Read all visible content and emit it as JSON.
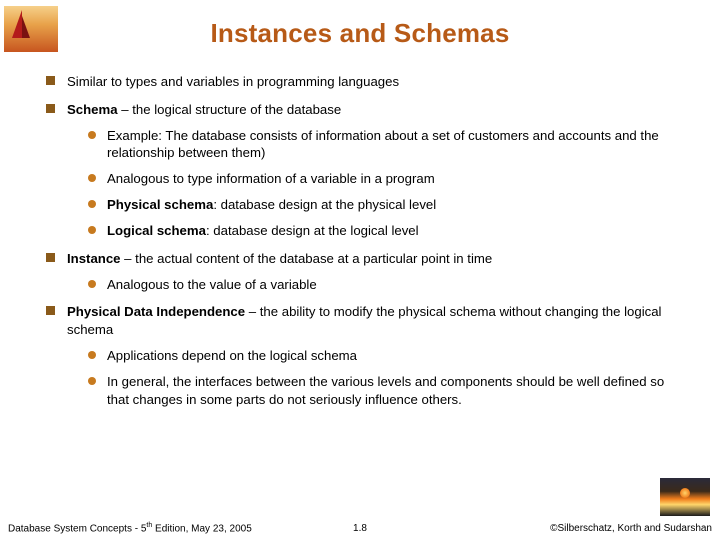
{
  "title": "Instances and Schemas",
  "bullets": [
    {
      "text": "Similar to types and variables in programming languages"
    },
    {
      "bold": "Schema",
      "rest": " – the logical structure of the database",
      "sub": [
        "Example: The database consists of information about a set of customers and accounts and the relationship between them)",
        "Analogous to type information of a variable in a program",
        {
          "bold": "Physical schema",
          "rest": ": database design at the physical level"
        },
        {
          "bold": "Logical schema",
          "rest": ": database design at the logical level"
        }
      ]
    },
    {
      "bold": "Instance",
      "rest": " – the actual content of the database at a particular point in time",
      "sub": [
        "Analogous to the value of a variable"
      ]
    },
    {
      "bold": "Physical Data Independence",
      "rest": " – the ability to modify the physical schema without changing the logical schema",
      "sub": [
        "Applications depend on the logical schema",
        "In general, the interfaces between the various levels and components should be well defined so that changes in some parts do not seriously influence others."
      ]
    }
  ],
  "footer": {
    "left_a": "Database System Concepts - 5",
    "left_sup": "th",
    "left_b": " Edition, May 23, 2005",
    "center": "1.8",
    "right": "©Silberschatz, Korth and Sudarshan"
  }
}
